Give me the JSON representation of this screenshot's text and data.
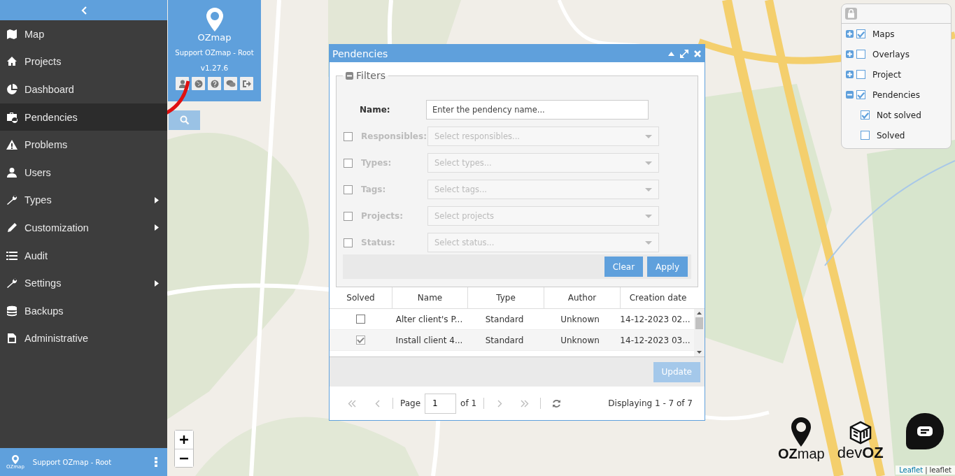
{
  "sidebar": {
    "items": [
      {
        "label": "Map",
        "selected": false,
        "has_submenu": false
      },
      {
        "label": "Projects",
        "selected": false,
        "has_submenu": false
      },
      {
        "label": "Dashboard",
        "selected": false,
        "has_submenu": false
      },
      {
        "label": "Pendencies",
        "selected": true,
        "has_submenu": false
      },
      {
        "label": "Problems",
        "selected": false,
        "has_submenu": false
      },
      {
        "label": "Users",
        "selected": false,
        "has_submenu": false
      },
      {
        "label": "Types",
        "selected": false,
        "has_submenu": true
      },
      {
        "label": "Customization",
        "selected": false,
        "has_submenu": true
      },
      {
        "label": "Audit",
        "selected": false,
        "has_submenu": false
      },
      {
        "label": "Settings",
        "selected": false,
        "has_submenu": true
      },
      {
        "label": "Backups",
        "selected": false,
        "has_submenu": false
      },
      {
        "label": "Administrative",
        "selected": false,
        "has_submenu": false
      }
    ],
    "footer": {
      "logo_text": "OZmap",
      "user": "Support OZmap - Root"
    }
  },
  "user_panel": {
    "logo": "OZmap",
    "user": "Support OZmap - Root",
    "version": "v1.27.6"
  },
  "dialog": {
    "title": "Pendencies",
    "filters": {
      "legend": "Filters",
      "expanded": true,
      "name": {
        "label": "Name:",
        "placeholder": "Enter the pendency name..."
      },
      "rows": [
        {
          "label": "Responsibles:",
          "placeholder": "Select responsibles...",
          "checked": false,
          "disabled": true
        },
        {
          "label": "Types:",
          "placeholder": "Select types...",
          "checked": false,
          "disabled": true
        },
        {
          "label": "Tags:",
          "placeholder": "Select tags...",
          "checked": false,
          "disabled": true
        },
        {
          "label": "Projects:",
          "placeholder": "Select projects",
          "checked": false,
          "disabled": true
        },
        {
          "label": "Status:",
          "placeholder": "Select status...",
          "checked": false,
          "disabled": true
        }
      ],
      "buttons": [
        "Clear",
        "Apply"
      ]
    },
    "table": {
      "columns": [
        "Solved",
        "Name",
        "Type",
        "Author",
        "Creation date"
      ],
      "rows": [
        {
          "solved": false,
          "name": "Alter client's P...",
          "type": "Standard",
          "author": "Unknown",
          "date": "14-12-2023 02..."
        },
        {
          "solved": true,
          "name": "Install client 4...",
          "type": "Standard",
          "author": "Unknown",
          "date": "14-12-2023 03..."
        }
      ]
    },
    "update_button": {
      "label": "Update",
      "disabled": true
    },
    "pager": {
      "page_label": "Page",
      "page": "1",
      "of": "of 1",
      "summary": "Displaying 1 - 7 of 7"
    }
  },
  "layers": {
    "items": [
      {
        "label": "Maps",
        "checked": true,
        "expanded": false
      },
      {
        "label": "Overlays",
        "checked": false,
        "expanded": false
      },
      {
        "label": "Project",
        "checked": false,
        "expanded": false
      },
      {
        "label": "Pendencies",
        "checked": true,
        "expanded": true,
        "children": [
          {
            "label": "Not solved",
            "checked": true
          },
          {
            "label": "Solved",
            "checked": false
          }
        ]
      }
    ]
  },
  "map_logos": {
    "left": {
      "bold": "OZ",
      "light": "map"
    },
    "right": {
      "light": "dev",
      "bold": "OZ"
    }
  },
  "attribution": {
    "link": "Leaflet",
    "separator": "|",
    "source": "leaflet"
  }
}
